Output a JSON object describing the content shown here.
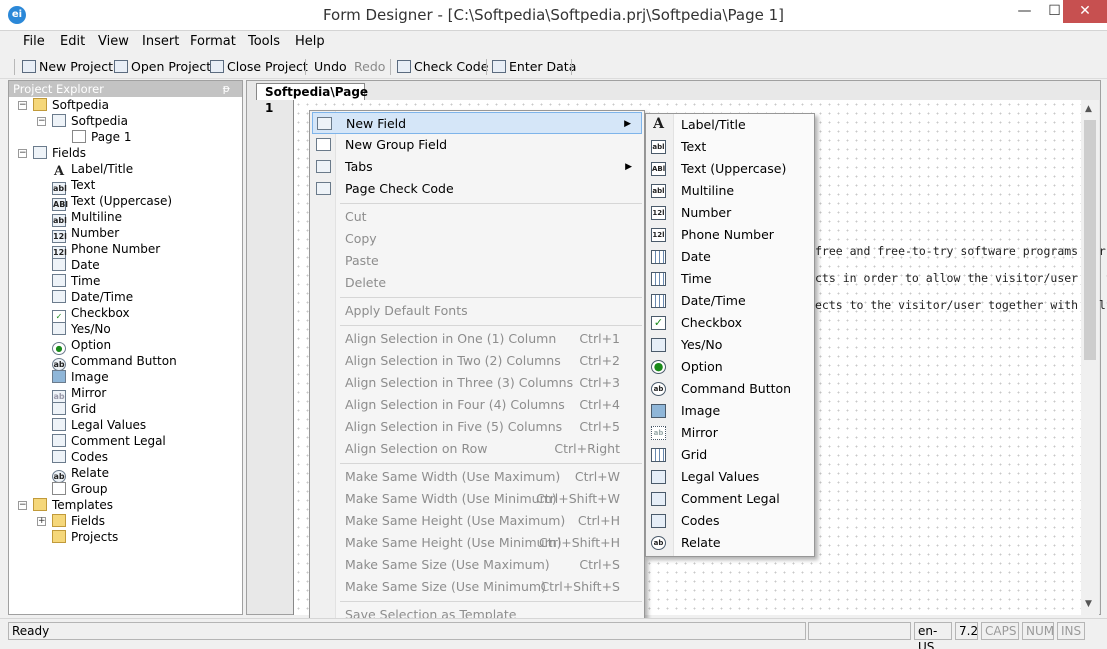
{
  "window": {
    "title": "Form Designer - [C:\\Softpedia\\Softpedia.prj\\Softpedia\\Page 1]",
    "app_icon_text": "ei",
    "minimize": "—",
    "maximize": "☐",
    "close": "✕"
  },
  "menubar": [
    "File",
    "Edit",
    "View",
    "Insert",
    "Format",
    "Tools",
    "Help"
  ],
  "toolbar": {
    "new_project": "New Project",
    "open_project": "Open Project",
    "close_project": "Close Project",
    "undo": "Undo",
    "redo": "Redo",
    "check_code": "Check Code",
    "enter_data": "Enter Data"
  },
  "explorer": {
    "title": "Project Explorer",
    "pin": "ᵽ",
    "tree": {
      "root": "Softpedia",
      "project": "Softpedia",
      "page": "Page 1",
      "fields": "Fields",
      "field_items": [
        "Label/Title",
        "Text",
        "Text (Uppercase)",
        "Multiline",
        "Number",
        "Phone Number",
        "Date",
        "Time",
        "Date/Time",
        "Checkbox",
        "Yes/No",
        "Option",
        "Command Button",
        "Image",
        "Mirror",
        "Grid",
        "Legal Values",
        "Comment Legal",
        "Codes",
        "Relate",
        "Group"
      ],
      "templates": "Templates",
      "template_fields": "Fields",
      "template_projects": "Projects"
    }
  },
  "document_tab": "Softpedia\\Page 1",
  "page_text": [
    "free and free-to-try software programs for W",
    "cts in order to allow the visitor/user to find the",
    "ects to the visitor/user together with self-made"
  ],
  "context_menu": {
    "new_field": "New Field",
    "new_group_field": "New Group Field",
    "tabs": "Tabs",
    "page_check_code": "Page Check Code",
    "cut": "Cut",
    "copy": "Copy",
    "paste": "Paste",
    "delete": "Delete",
    "apply_default_fonts": "Apply Default Fonts",
    "align_items": [
      {
        "label": "Align Selection in One (1) Column",
        "shortcut": "Ctrl+1"
      },
      {
        "label": "Align Selection in Two (2) Columns",
        "shortcut": "Ctrl+2"
      },
      {
        "label": "Align Selection in Three (3) Columns",
        "shortcut": "Ctrl+3"
      },
      {
        "label": "Align Selection in Four (4) Columns",
        "shortcut": "Ctrl+4"
      },
      {
        "label": "Align Selection in Five (5) Columns",
        "shortcut": "Ctrl+5"
      },
      {
        "label": "Align Selection on Row",
        "shortcut": "Ctrl+Right"
      }
    ],
    "size_items": [
      {
        "label": "Make Same Width (Use Maximum)",
        "shortcut": "Ctrl+W"
      },
      {
        "label": "Make Same Width (Use Minimum)",
        "shortcut": "Ctrl+Shift+W"
      },
      {
        "label": "Make Same Height (Use Maximum)",
        "shortcut": "Ctrl+H"
      },
      {
        "label": "Make Same Height (Use Minimum)",
        "shortcut": "Ctrl+Shift+H"
      },
      {
        "label": "Make Same Size (Use Maximum)",
        "shortcut": "Ctrl+S"
      },
      {
        "label": "Make Same Size (Use Minimum)",
        "shortcut": "Ctrl+Shift+S"
      }
    ],
    "save_selection": "Save Selection as Template"
  },
  "submenu": [
    {
      "label": "Label/Title",
      "icon": "A"
    },
    {
      "label": "Text",
      "icon": "abl"
    },
    {
      "label": "Text (Uppercase)",
      "icon": "ABl"
    },
    {
      "label": "Multiline",
      "icon": "abl"
    },
    {
      "label": "Number",
      "icon": "12l"
    },
    {
      "label": "Phone Number",
      "icon": "12l"
    },
    {
      "label": "Date",
      "icon": ""
    },
    {
      "label": "Time",
      "icon": ""
    },
    {
      "label": "Date/Time",
      "icon": ""
    },
    {
      "label": "Checkbox",
      "icon": "✓"
    },
    {
      "label": "Yes/No",
      "icon": ""
    },
    {
      "label": "Option",
      "icon": "●"
    },
    {
      "label": "Command Button",
      "icon": "ab"
    },
    {
      "label": "Image",
      "icon": ""
    },
    {
      "label": "Mirror",
      "icon": "ab"
    },
    {
      "label": "Grid",
      "icon": ""
    },
    {
      "label": "Legal Values",
      "icon": ""
    },
    {
      "label": "Comment Legal",
      "icon": ""
    },
    {
      "label": "Codes",
      "icon": ""
    },
    {
      "label": "Relate",
      "icon": "ab"
    }
  ],
  "statusbar": {
    "status": "Ready",
    "locale": "en-US",
    "version": "7.2",
    "caps": "CAPS",
    "num": "NUM",
    "ins": "INS"
  }
}
